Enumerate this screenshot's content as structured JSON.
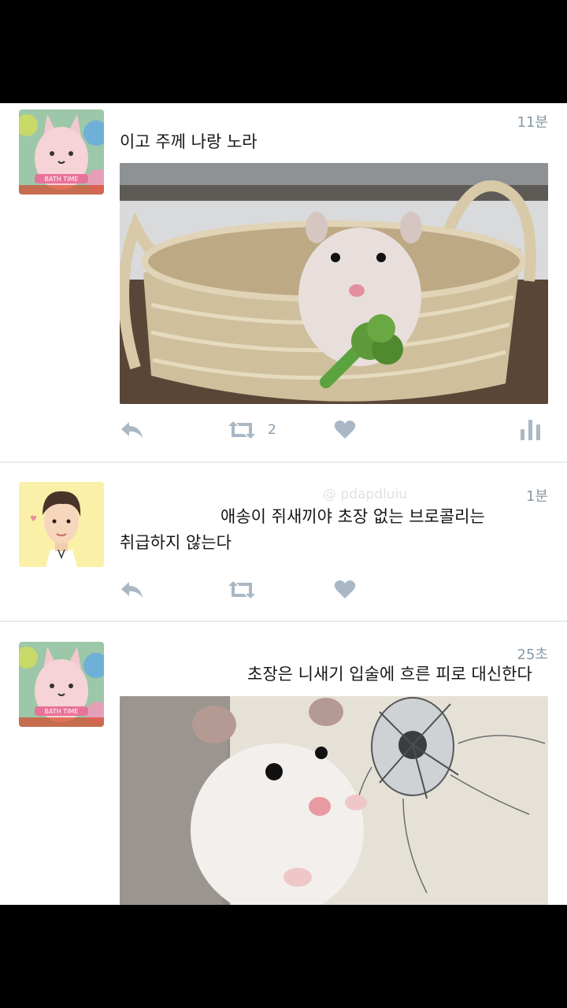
{
  "tweets": [
    {
      "time": "11분",
      "text": "이고 주께 나랑 노라",
      "retweet_count": "2",
      "avatar_icon": "bunny-avatar-icon",
      "avatar_badge": "BATH TIME"
    },
    {
      "time": "1분",
      "handle_faded": "@ pdapdluiu",
      "text_line1": "애송이 쥐새끼야 초장 없는 브로콜리는",
      "text_line2": "취급하지 않는다",
      "avatar_icon": "man-avatar-icon"
    },
    {
      "time": "25초",
      "text": "초장은 니새기 입술에 흐른 피로 대신한다",
      "avatar_icon": "bunny-avatar-icon",
      "avatar_badge": "BATH TIME"
    }
  ],
  "colors": {
    "action_icon": "#a9b8c4",
    "time": "#8899a6",
    "text": "#14171a",
    "separator": "#e6ecf0"
  }
}
